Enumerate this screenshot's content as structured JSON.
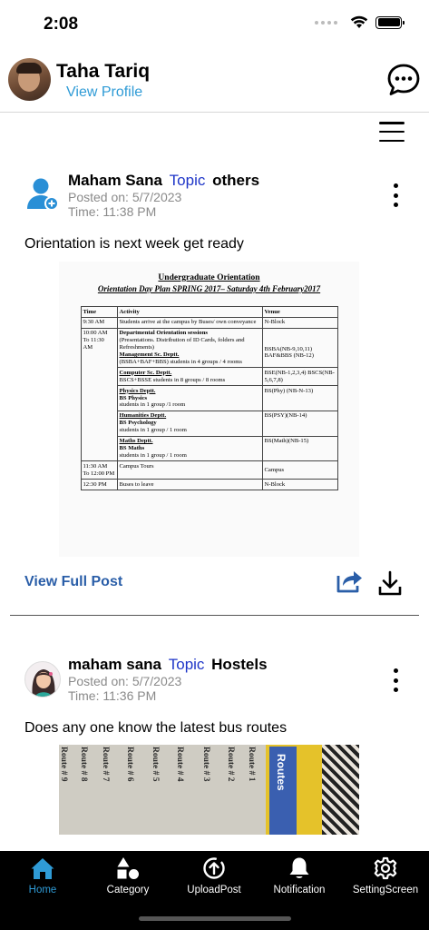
{
  "status": {
    "time": "2:08"
  },
  "header": {
    "name": "Taha Tariq",
    "view_profile": "View Profile"
  },
  "posts": [
    {
      "author": "Maham Sana",
      "topic_label": "Topic",
      "topic": "others",
      "posted_on": "Posted on: 5/7/2023",
      "time": "Time: 11:38 PM",
      "text": "Orientation is next week get ready",
      "image_doc": {
        "title": "Undergraduate Orientation",
        "subtitle": "Orientation Day Plan SPRING 2017– Saturday 4th February2017",
        "headers": [
          "Time",
          "Activity",
          "Venue"
        ],
        "rows": [
          {
            "time": "9:30 AM",
            "activity": "Students arrive at the campus by Buses/ own conveyance",
            "venue": "N-Block"
          },
          {
            "time": "10:00 AM To 11:30 AM",
            "activity_head": "Departmental Orientation sessions",
            "activity": "(Presentations. Distribution of ID Cards, folders and Refreshments)",
            "dept": "Management Sc. Deptt.",
            "dept_detail": "(BSBA+BAF+BBS) students in 4 groups / 4 rooms",
            "venue": "BSBA(NB-9,10,11) BAF&BBS (NB-12)"
          },
          {
            "time": "",
            "dept": "Computer Sc. Deptt.",
            "dept_detail": "BSCS+BSSE students in 8 groups / 8 rooms",
            "venue": "BSE(NB-1,2,3,4) BSCS(NB-5,6,7,8)"
          },
          {
            "time": "",
            "dept": "Physics Deptt.",
            "dept_sub": "BS Physics",
            "dept_detail": "students in 1 group /1 room",
            "venue": "BS(Phy) (NB-N-13)"
          },
          {
            "time": "",
            "dept": "Humanities Deptt.",
            "dept_sub": "BS Psychology",
            "dept_detail": "students in 1 group / 1 room",
            "venue": "BS(PSY)(NB-14)"
          },
          {
            "time": "",
            "dept": "Maths Deptt.",
            "dept_sub": "BS Maths",
            "dept_detail": "students in 1 group / 1 room",
            "venue": "BS(Math)(NB-15)"
          },
          {
            "time": "11:30 AM To 12:00 PM",
            "activity": "Campus Tours",
            "venue": "Campus"
          },
          {
            "time": "12:30 PM",
            "activity": "Buses to leave",
            "venue": "N-Block"
          }
        ]
      },
      "view_full": "View Full Post"
    },
    {
      "author": "maham sana",
      "topic_label": "Topic",
      "topic": "Hostels",
      "posted_on": "Posted on: 5/7/2023",
      "time": "Time: 11:36 PM",
      "text": "Does any one know the latest bus routes",
      "image_routes": {
        "columns": [
          "Route # 9",
          "Route # 8",
          "Route # 7",
          "Route # 6",
          "Route # 5",
          "Route # 4",
          "Route # 3",
          "Route # 2",
          "Route # 1"
        ],
        "book_title": "Routes"
      }
    }
  ],
  "tabs": [
    {
      "label": "Home",
      "icon": "home-icon",
      "active": true
    },
    {
      "label": "Category",
      "icon": "category-shapes-icon",
      "active": false
    },
    {
      "label": "UploadPost",
      "icon": "upload-icon",
      "active": false
    },
    {
      "label": "Notification",
      "icon": "bell-icon",
      "active": false
    },
    {
      "label": "SettingScreen",
      "icon": "gear-icon",
      "active": false
    }
  ],
  "colors": {
    "link_blue": "#2f9bd6",
    "topic_blue": "#1e35c8",
    "view_full_blue": "#2a5ea8",
    "tabbar_bg": "#000000"
  }
}
